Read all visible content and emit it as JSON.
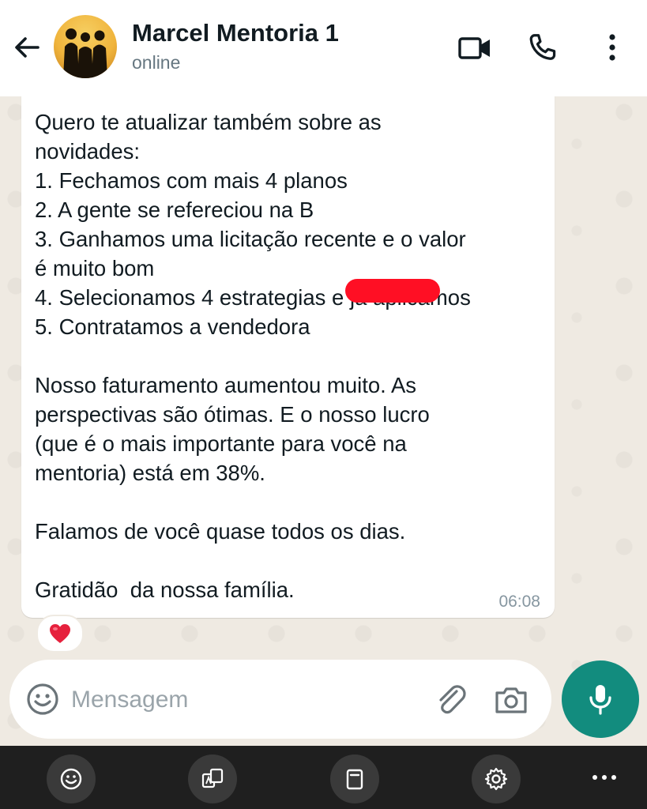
{
  "header": {
    "contact_name": "Marcel Mentoria 1",
    "status": "online"
  },
  "message": {
    "text": "Quero te atualizar também sobre as\nnovidades:\n1. Fechamos com mais 4 planos\n2. A gente se refereciou na B\n3. Ganhamos uma licitação recente e o valor\né muito bom\n4. Selecionamos 4 estrategias e já aplicamos\n5. Contratamos a vendedora\n\nNosso faturamento aumentou muito. As\nperspectivas são ótimas. E o nosso lucro\n(que é o mais importante para você na\nmentoria) está em 38%.\n\nFalamos de você quase todos os dias.\n\nGratidão  da nossa família.",
    "time": "06:08",
    "reaction": "❤️"
  },
  "composer": {
    "placeholder": "Mensagem"
  },
  "colors": {
    "accent": "#128c7e",
    "chat_bg": "#efeae2",
    "redaction": "#ff0f24",
    "keyboard_bar": "#1f1f1f"
  },
  "icons": {
    "header": [
      "back-arrow-icon",
      "video-call-icon",
      "phone-icon",
      "more-vertical-icon"
    ],
    "composer": [
      "emoji-icon",
      "attach-icon",
      "camera-icon",
      "mic-icon"
    ],
    "keyboard_bar": [
      "emoji-icon",
      "translate-icon",
      "clipboard-icon",
      "settings-icon",
      "more-horizontal-icon"
    ]
  }
}
